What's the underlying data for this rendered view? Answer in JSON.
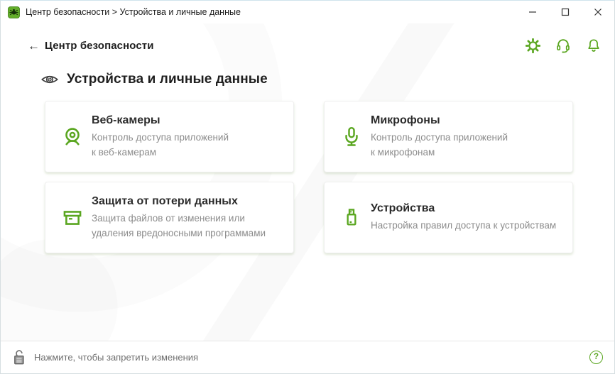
{
  "window": {
    "title": "Центр безопасности > Устройства и личные данные"
  },
  "header": {
    "back_arrow": "←",
    "back_label": "Центр безопасности",
    "icons": [
      "settings-gear",
      "support-headset",
      "notifications-bell"
    ]
  },
  "page": {
    "title": "Устройства и личные данные",
    "title_icon": "eye-icon"
  },
  "cards": [
    {
      "icon": "webcam-icon",
      "title": "Веб-камеры",
      "description": "Контроль доступа приложений\nк веб-камерам"
    },
    {
      "icon": "microphone-icon",
      "title": "Микрофоны",
      "description": "Контроль доступа приложений\nк микрофонам"
    },
    {
      "icon": "data-loss-protection-icon",
      "title": "Защита от потери данных",
      "description": "Защита файлов от изменения или\nудаления вредоносными программами"
    },
    {
      "icon": "usb-device-icon",
      "title": "Устройства",
      "description": "Настройка правил доступа к устройствам"
    }
  ],
  "footer": {
    "lock_text": "Нажмите, чтобы запретить изменения",
    "help_glyph": "?"
  },
  "colors": {
    "accent_green": "#5aa620",
    "title_text": "#1e1e1e",
    "description_text": "#8c8c8c"
  }
}
